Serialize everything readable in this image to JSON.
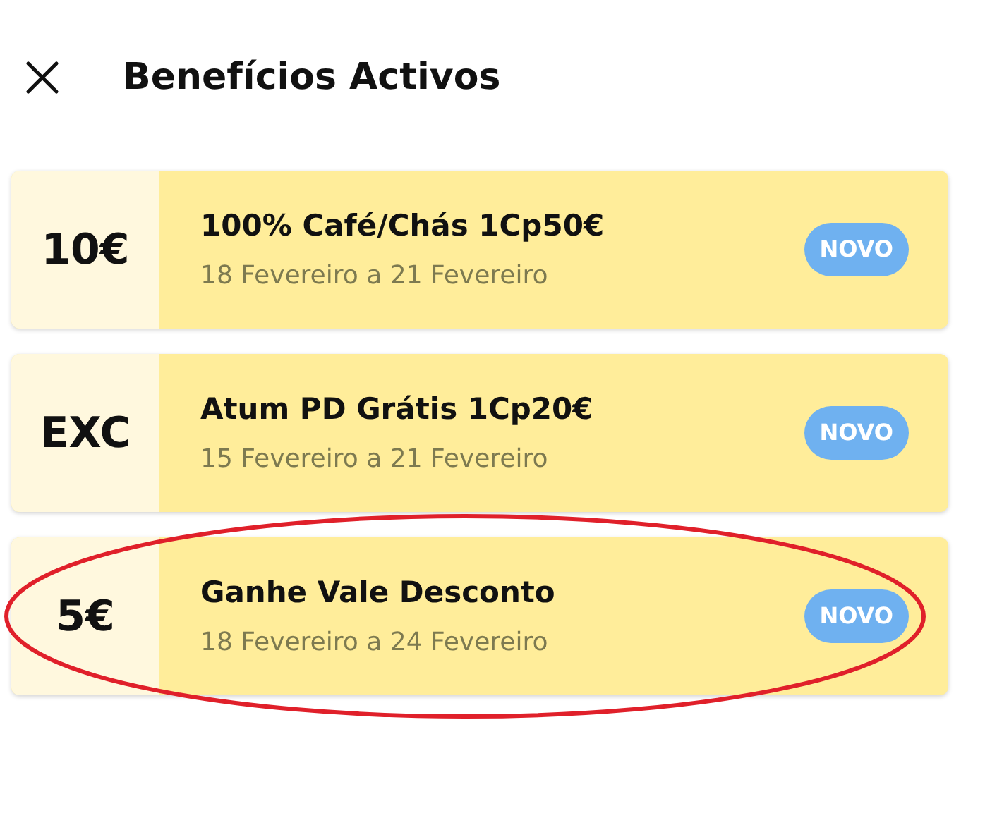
{
  "header": {
    "title": "Benefícios Activos"
  },
  "benefits": [
    {
      "value": "10€",
      "title": "100% Café/Chás 1Cp50€",
      "dates": "18 Fevereiro a 21 Fevereiro",
      "badge": "NOVO",
      "highlighted": false
    },
    {
      "value": "EXC",
      "title": "Atum PD Grátis 1Cp20€",
      "dates": "15 Fevereiro a 21 Fevereiro",
      "badge": "NOVO",
      "highlighted": false
    },
    {
      "value": "5€",
      "title": "Ganhe Vale Desconto",
      "dates": "18 Fevereiro a 24 Fevereiro",
      "badge": "NOVO",
      "highlighted": true
    }
  ]
}
